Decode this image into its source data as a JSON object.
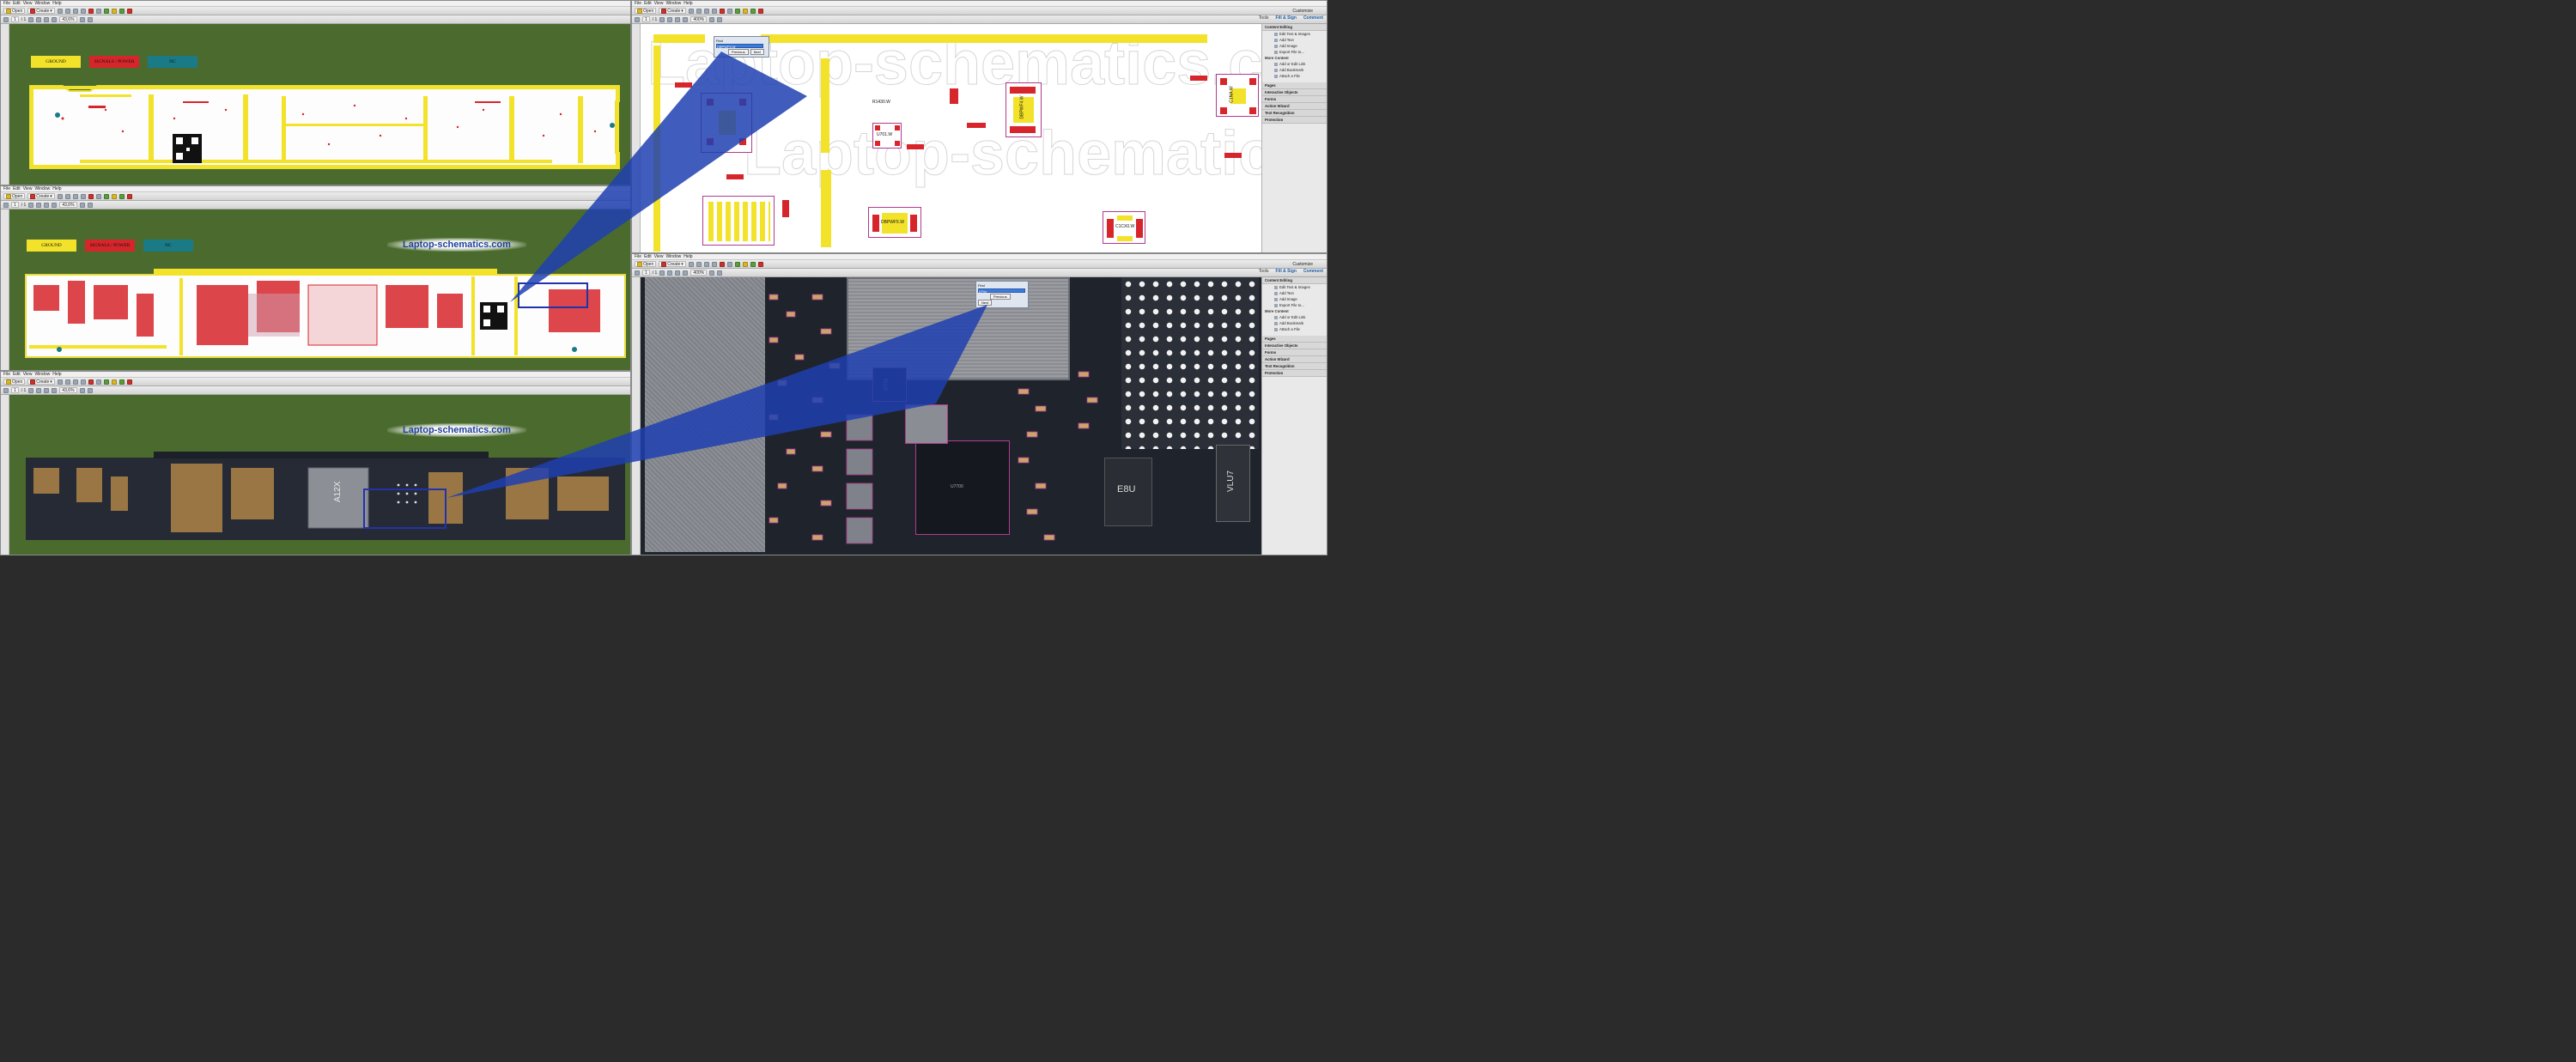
{
  "menu": [
    "File",
    "Edit",
    "View",
    "Window",
    "Help"
  ],
  "toolbar": {
    "open": "Open",
    "create": "Create",
    "customize": "Customize"
  },
  "left_windows": [
    {
      "page": "1",
      "pages": "/ 1",
      "zoom": "43,6%"
    },
    {
      "page": "1",
      "pages": "/ 1",
      "zoom": "43,6%"
    },
    {
      "page": "1",
      "pages": "/ 1",
      "zoom": "43,6%"
    }
  ],
  "right_windows": [
    {
      "page": "1",
      "pages": "/ 1",
      "zoom": "400%"
    },
    {
      "page": "1",
      "pages": "/ 1",
      "zoom": "400%"
    }
  ],
  "legend": {
    "ground": "GROUND",
    "signals": "SIGNALS / POWER",
    "nc": "NC"
  },
  "brand": "Laptop-schematics.com",
  "panel_tabs": {
    "tools": "Tools",
    "fill_sign": "Fill & Sign",
    "comment": "Comment"
  },
  "find": {
    "label": "Find",
    "previous": "Previous",
    "next": "Next",
    "query_top": "DBPWF5.W",
    "query_bottom": "U7xx"
  },
  "right_panel": {
    "content_editing": "Content Editing",
    "items": [
      "Edit Text & Images",
      "Add Text",
      "Add Image",
      "Export File to..."
    ],
    "more_content": "More Content",
    "more_items": [
      "Add or Edit Link",
      "Add Bookmark",
      "Attach a File"
    ],
    "sections": [
      "Pages",
      "Interactive Objects",
      "Forms",
      "Action Wizard",
      "Text Recognition",
      "Protection"
    ]
  },
  "schematic_labels": {
    "dbpwf5": "DBPWF5.W",
    "dbpwf4": "DBPWF4.W",
    "u701": "U701.W",
    "c1": "C1CX0.W",
    "r1": "R1430.W",
    "c2": "C1NA.W"
  },
  "chip_labels": {
    "a12x": "A12X",
    "u7700": "U7700",
    "u7702": "U7702",
    "e8u": "E8U",
    "vl": "VLU7"
  },
  "colors": {
    "ground": "#f2e32a",
    "signals": "#d7262b",
    "nc": "#1a7a86",
    "board_bg": "#4a6b2d",
    "find_line": "#1f3fb0"
  }
}
